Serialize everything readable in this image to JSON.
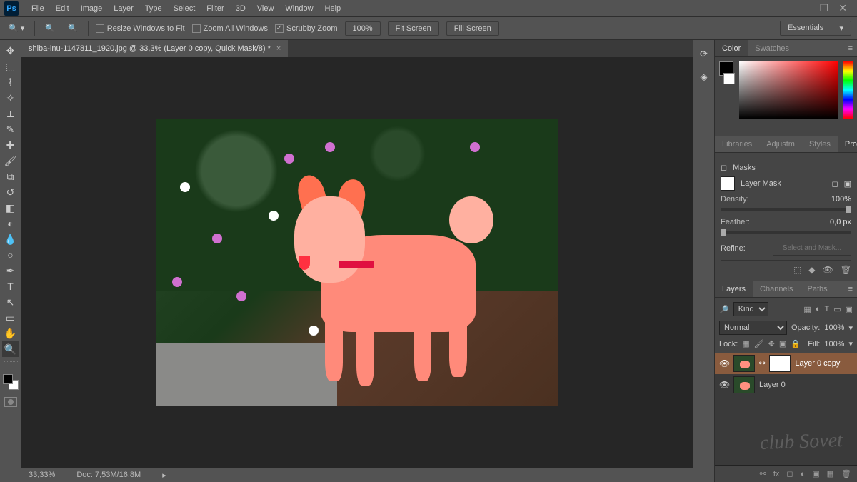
{
  "menu": {
    "items": [
      "File",
      "Edit",
      "Image",
      "Layer",
      "Type",
      "Select",
      "Filter",
      "3D",
      "View",
      "Window",
      "Help"
    ]
  },
  "window_controls": {
    "min": "—",
    "max": "❐",
    "close": "✕"
  },
  "options_bar": {
    "resize_windows": "Resize Windows to Fit",
    "zoom_all": "Zoom All Windows",
    "scrubby": "Scrubby Zoom",
    "scrubby_checked": true,
    "zoom_pct": "100%",
    "fit": "Fit Screen",
    "fill": "Fill Screen",
    "workspace": "Essentials"
  },
  "document": {
    "tab_title": "shiba-inu-1147811_1920.jpg @ 33,3% (Layer 0 copy, Quick Mask/8) *",
    "zoom": "33,33%",
    "doc_size": "Doc: 7,53M/16,8M"
  },
  "tools": [
    "move",
    "marquee",
    "lasso",
    "wand",
    "crop",
    "eyedropper",
    "heal",
    "brush",
    "stamp",
    "history",
    "eraser",
    "gradient",
    "blur",
    "dodge",
    "pen",
    "type",
    "path",
    "shape",
    "hand",
    "zoom"
  ],
  "color_panel": {
    "tabs": [
      "Color",
      "Swatches"
    ],
    "active": 0
  },
  "mid_tabs": {
    "tabs": [
      "Libraries",
      "Adjustm",
      "Styles",
      "Properties"
    ],
    "active": 3
  },
  "properties": {
    "title": "Masks",
    "mask_label": "Layer Mask",
    "density_label": "Density:",
    "density_value": "100%",
    "feather_label": "Feather:",
    "feather_value": "0,0 px",
    "refine_label": "Refine:",
    "refine_btn": "Select and Mask..."
  },
  "layers_panel": {
    "tabs": [
      "Layers",
      "Channels",
      "Paths"
    ],
    "active": 0,
    "kind": "Kind",
    "blend": "Normal",
    "opacity_label": "Opacity:",
    "opacity_value": "100%",
    "lock_label": "Lock:",
    "fill_label": "Fill:",
    "fill_value": "100%",
    "layers": [
      {
        "name": "Layer 0 copy",
        "has_mask": true,
        "selected": true
      },
      {
        "name": "Layer 0",
        "has_mask": false,
        "selected": false
      }
    ]
  },
  "watermark": "club Sovet",
  "tool_icons": {
    "move": "✥",
    "marquee": "⬚",
    "lasso": "⌇",
    "wand": "✧",
    "crop": "⟂",
    "eyedropper": "✎",
    "heal": "✚",
    "brush": "🖌",
    "stamp": "⧉",
    "history": "↺",
    "eraser": "◧",
    "gradient": "◐",
    "blur": "💧",
    "dodge": "○",
    "pen": "✒",
    "type": "T",
    "path": "↖",
    "shape": "▭",
    "hand": "✋",
    "zoom": "🔍"
  }
}
